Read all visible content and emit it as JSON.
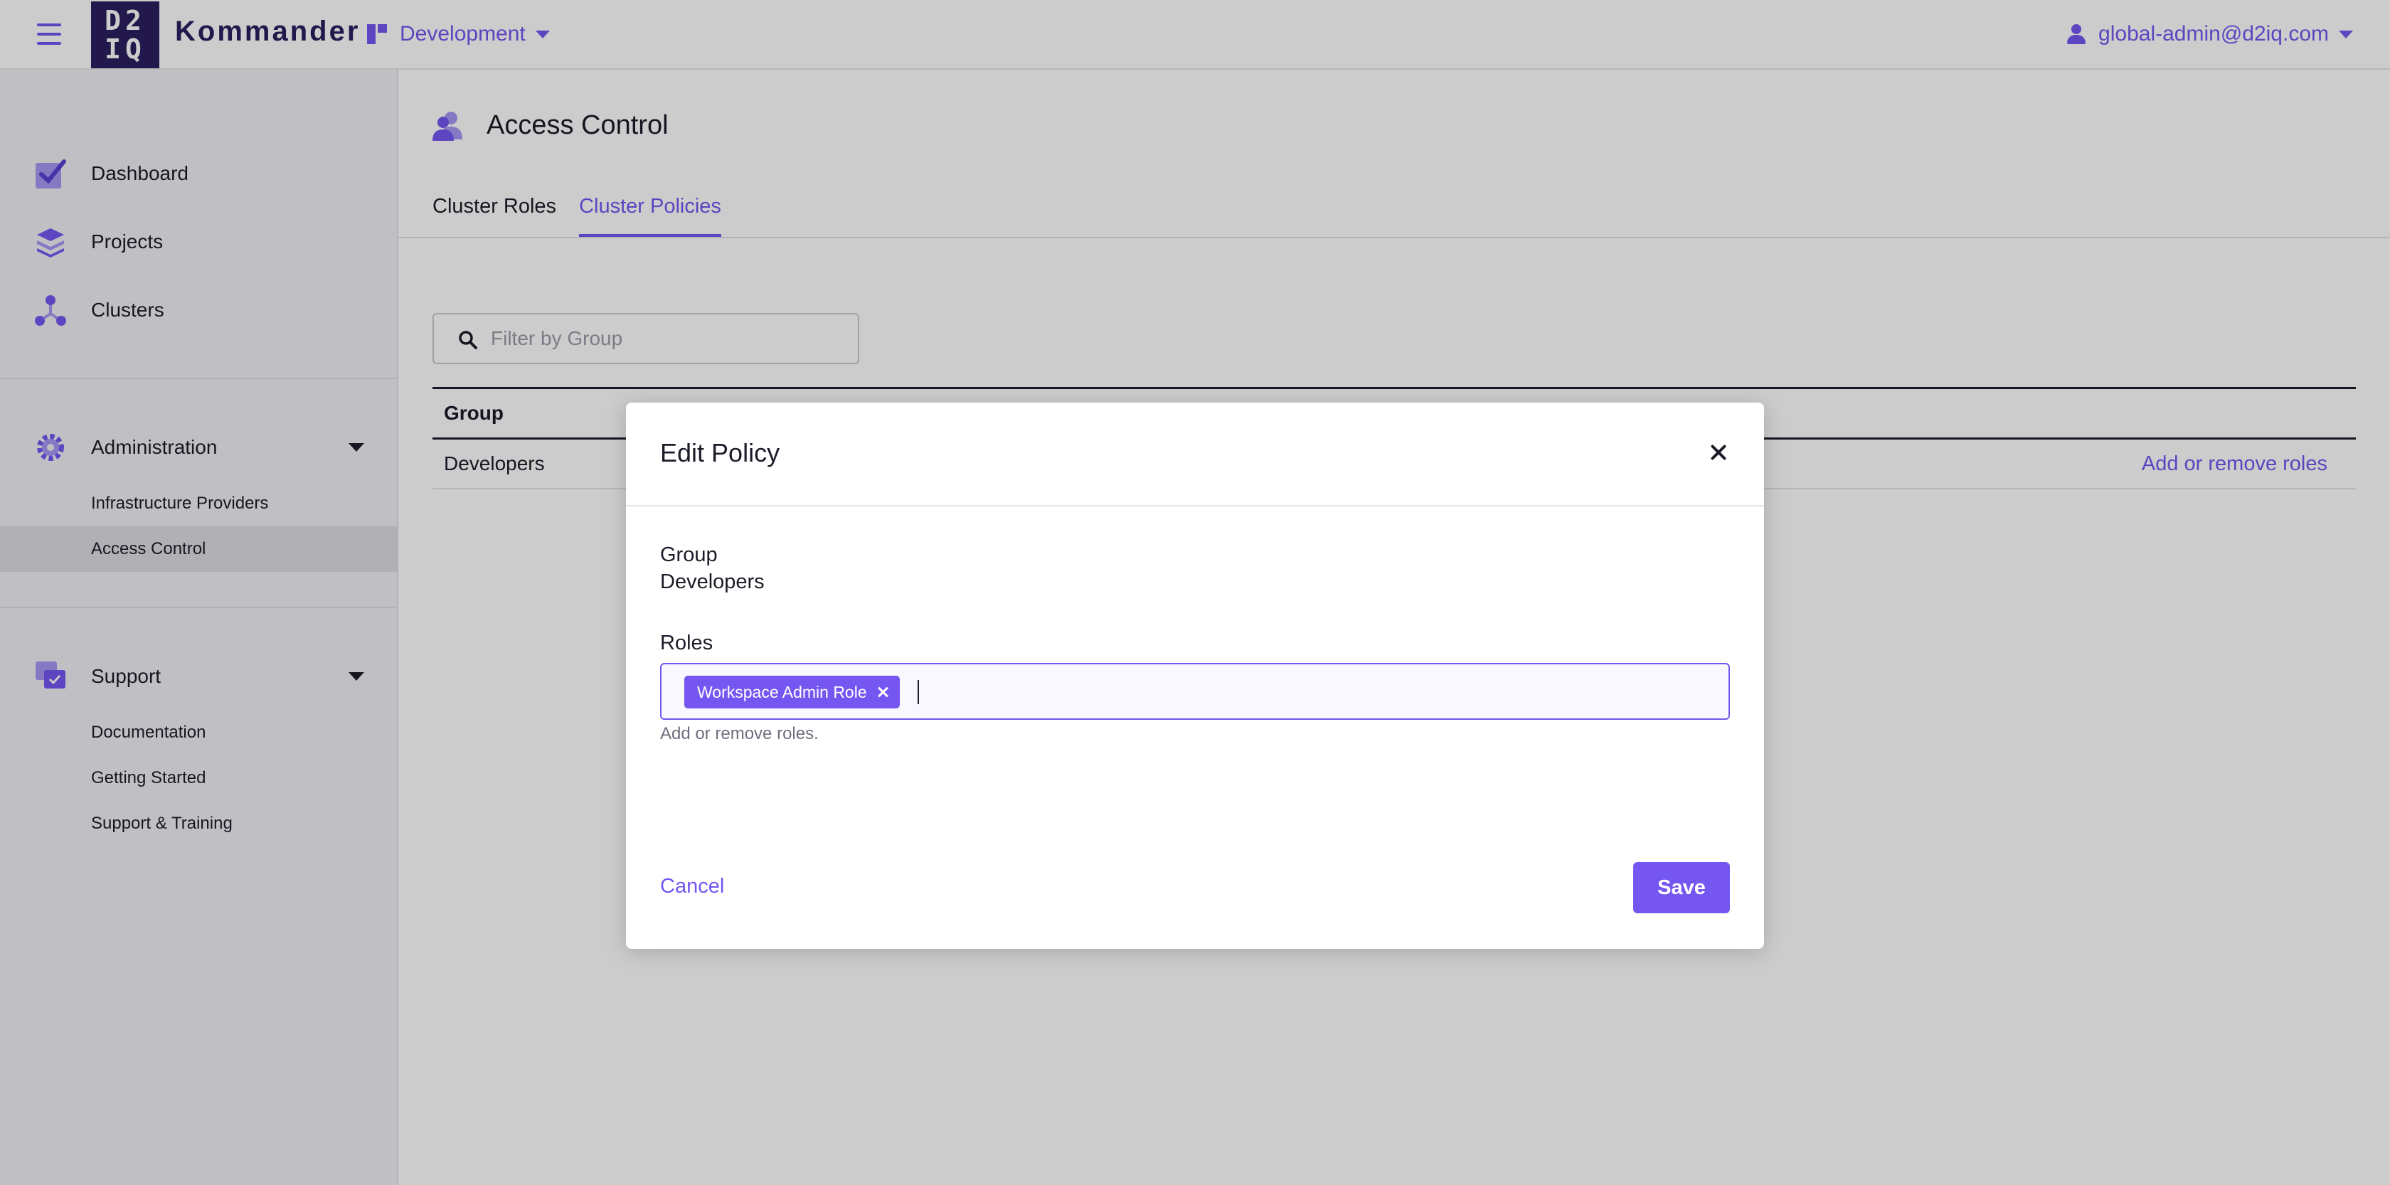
{
  "header": {
    "logo_text_top": "D2",
    "logo_text_bottom": "IQ",
    "brand": "Kommander",
    "workspace": "Development",
    "user": "global-admin@d2iq.com"
  },
  "sidebar": {
    "items": [
      {
        "label": "Dashboard",
        "icon": "dashboard-icon"
      },
      {
        "label": "Projects",
        "icon": "projects-icon"
      },
      {
        "label": "Clusters",
        "icon": "clusters-icon"
      }
    ],
    "administration": {
      "label": "Administration",
      "icon": "gear-icon",
      "sub_items": [
        "Infrastructure Providers",
        "Access Control"
      ]
    },
    "support": {
      "label": "Support",
      "icon": "support-icon",
      "sub_items": [
        "Documentation",
        "Getting Started",
        "Support & Training"
      ]
    }
  },
  "main": {
    "title": "Access Control",
    "tabs": [
      {
        "label": "Cluster Roles",
        "active": false
      },
      {
        "label": "Cluster Policies",
        "active": true
      }
    ],
    "filter_placeholder": "Filter by Group",
    "table": {
      "columns": [
        "Group"
      ],
      "rows": [
        {
          "group": "Developers",
          "action": "Add or remove roles"
        }
      ]
    }
  },
  "modal": {
    "title": "Edit Policy",
    "group_label": "Group",
    "group_value": "Developers",
    "roles_label": "Roles",
    "selected_roles": [
      "Workspace Admin Role"
    ],
    "roles_help": "Add or remove roles.",
    "cancel_label": "Cancel",
    "save_label": "Save"
  },
  "colors": {
    "accent": "#7556f0",
    "logo_background": "#2c1f5e",
    "overlay": "rgba(0,0,0,0.20)"
  }
}
